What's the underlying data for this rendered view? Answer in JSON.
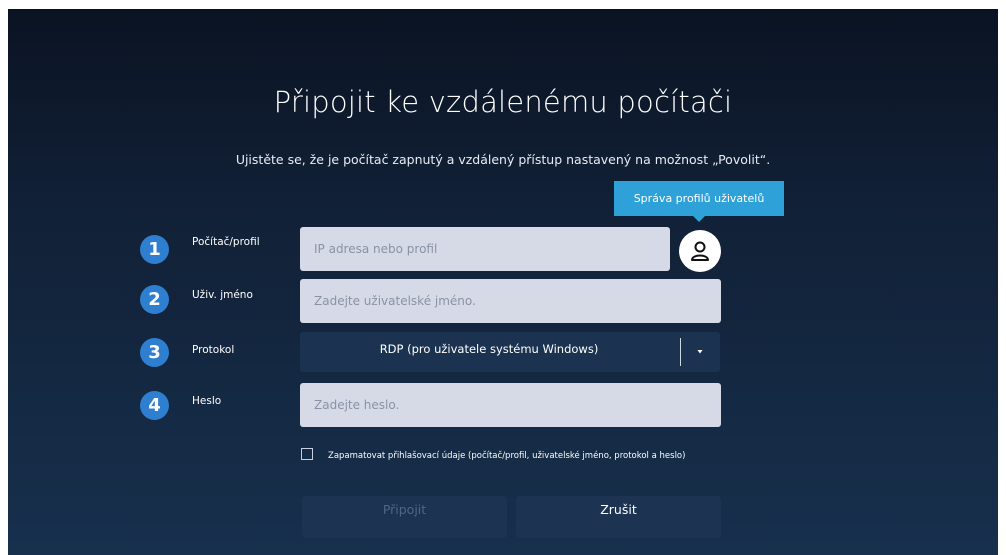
{
  "title": "Připojit ke vzdálenému počítači",
  "subtitle": "Ujistěte se, že je počítač zapnutý a vzdálený přístup nastavený na možnost „Povolit“.",
  "tooltip": "Správa profilů uživatelů",
  "steps": [
    {
      "number": "1",
      "label": "Počítač/profil"
    },
    {
      "number": "2",
      "label": "Uživ. jméno"
    },
    {
      "number": "3",
      "label": "Protokol"
    },
    {
      "number": "4",
      "label": "Heslo"
    }
  ],
  "fields": {
    "computer_placeholder": "IP adresa nebo profil",
    "username_placeholder": "Zadejte uživatelské jméno.",
    "protocol_value": "RDP (pro uživatele systému Windows)",
    "password_placeholder": "Zadejte heslo."
  },
  "remember_label": "Zapamatovat přihlašovací údaje (počítač/profil, uživatelské jméno, protokol a heslo)",
  "buttons": {
    "connect": "Připojit",
    "cancel": "Zrušit"
  },
  "icons": {
    "profile": "user-profile-icon",
    "dropdown": "chevron-down-icon"
  },
  "colors": {
    "step_badge": "#2f7fd0",
    "tooltip": "#2ea2d8",
    "field": "#d5dae6"
  }
}
